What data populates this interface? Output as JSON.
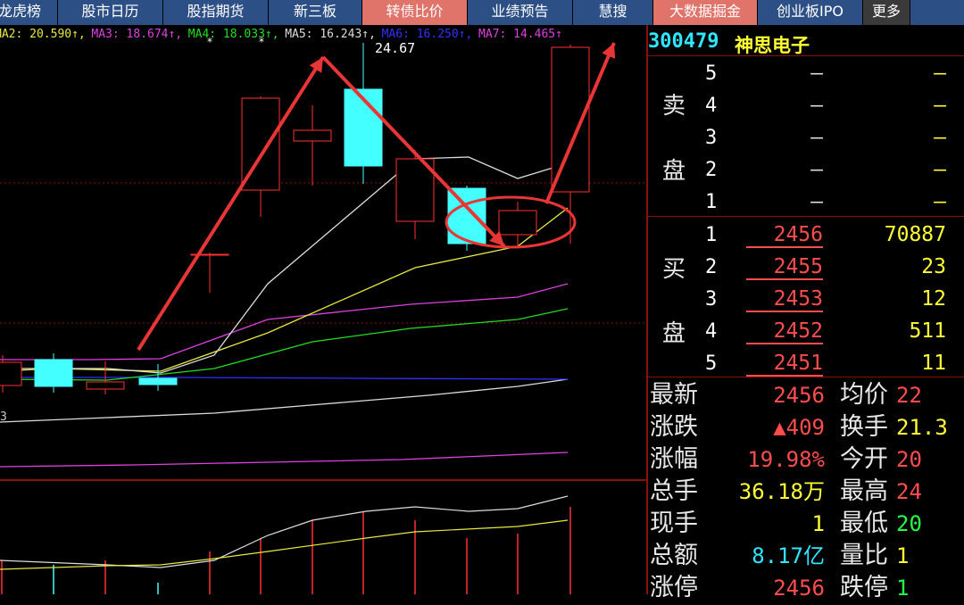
{
  "tabs": [
    {
      "label": "龙虎榜",
      "highlight": false
    },
    {
      "label": "股市日历",
      "highlight": false
    },
    {
      "label": "股指期货",
      "highlight": false
    },
    {
      "label": "新三板",
      "highlight": false
    },
    {
      "label": "转债比价",
      "highlight": true
    },
    {
      "label": "业绩预告",
      "highlight": false
    },
    {
      "label": "慧搜",
      "highlight": false
    },
    {
      "label": "大数据掘金",
      "highlight": true
    },
    {
      "label": "创业板IPO",
      "highlight": false
    },
    {
      "label": "更多",
      "highlight": false
    }
  ],
  "ma_legend": [
    {
      "text": "MA2: 20.590↑,",
      "color": "#e8e840"
    },
    {
      "text": "MA3: 18.674↑,",
      "color": "#e040e0"
    },
    {
      "text": "MA4: 18.033↑,",
      "color": "#22dd22"
    },
    {
      "text": "MA5: 16.243↑,",
      "color": "#dddddd"
    },
    {
      "text": "MA6: 16.250↑,",
      "color": "#3030ff"
    },
    {
      "text": "MA7: 14.465↑",
      "color": "#e040e0"
    }
  ],
  "chart_labels": {
    "high_price": "24.67",
    "left_edge_value": "3"
  },
  "stock": {
    "code": "300479",
    "name": "神思电子"
  },
  "orderbook": {
    "sell_label": [
      "卖",
      "盘"
    ],
    "buy_label": [
      "买",
      "盘"
    ],
    "sell": [
      {
        "level": "5",
        "price": "—",
        "vol": "—"
      },
      {
        "level": "4",
        "price": "—",
        "vol": "—"
      },
      {
        "level": "3",
        "price": "—",
        "vol": "—"
      },
      {
        "level": "2",
        "price": "—",
        "vol": "—"
      },
      {
        "level": "1",
        "price": "—",
        "vol": "—"
      }
    ],
    "buy": [
      {
        "level": "1",
        "price": "2456",
        "vol": "70887"
      },
      {
        "level": "2",
        "price": "2455",
        "vol": "23"
      },
      {
        "level": "3",
        "price": "2453",
        "vol": "12"
      },
      {
        "level": "4",
        "price": "2452",
        "vol": "511"
      },
      {
        "level": "5",
        "price": "2451",
        "vol": "11"
      }
    ]
  },
  "quote": [
    {
      "label": "最新",
      "value": "2456",
      "color": "red",
      "label2": "均价",
      "value2": "22",
      "color2": "red"
    },
    {
      "label": "涨跌",
      "value": "▲409",
      "color": "red",
      "label2": "换手",
      "value2": "21.3",
      "color2": "yellow"
    },
    {
      "label": "涨幅",
      "value": "19.98%",
      "color": "red",
      "label2": "今开",
      "value2": "20",
      "color2": "red"
    },
    {
      "label": "总手",
      "value": "36.18万",
      "color": "yellow",
      "label2": "最高",
      "value2": "24",
      "color2": "red"
    },
    {
      "label": "现手",
      "value": "1",
      "color": "yellow",
      "label2": "最低",
      "value2": "20",
      "color2": "green"
    },
    {
      "label": "总额",
      "value": "8.17亿",
      "color": "cyan",
      "label2": "量比",
      "value2": "1",
      "color2": "yellow"
    },
    {
      "label": "涨停",
      "value": "2456",
      "color": "red",
      "label2": "跌停",
      "value2": "1",
      "color2": "green"
    }
  ]
}
